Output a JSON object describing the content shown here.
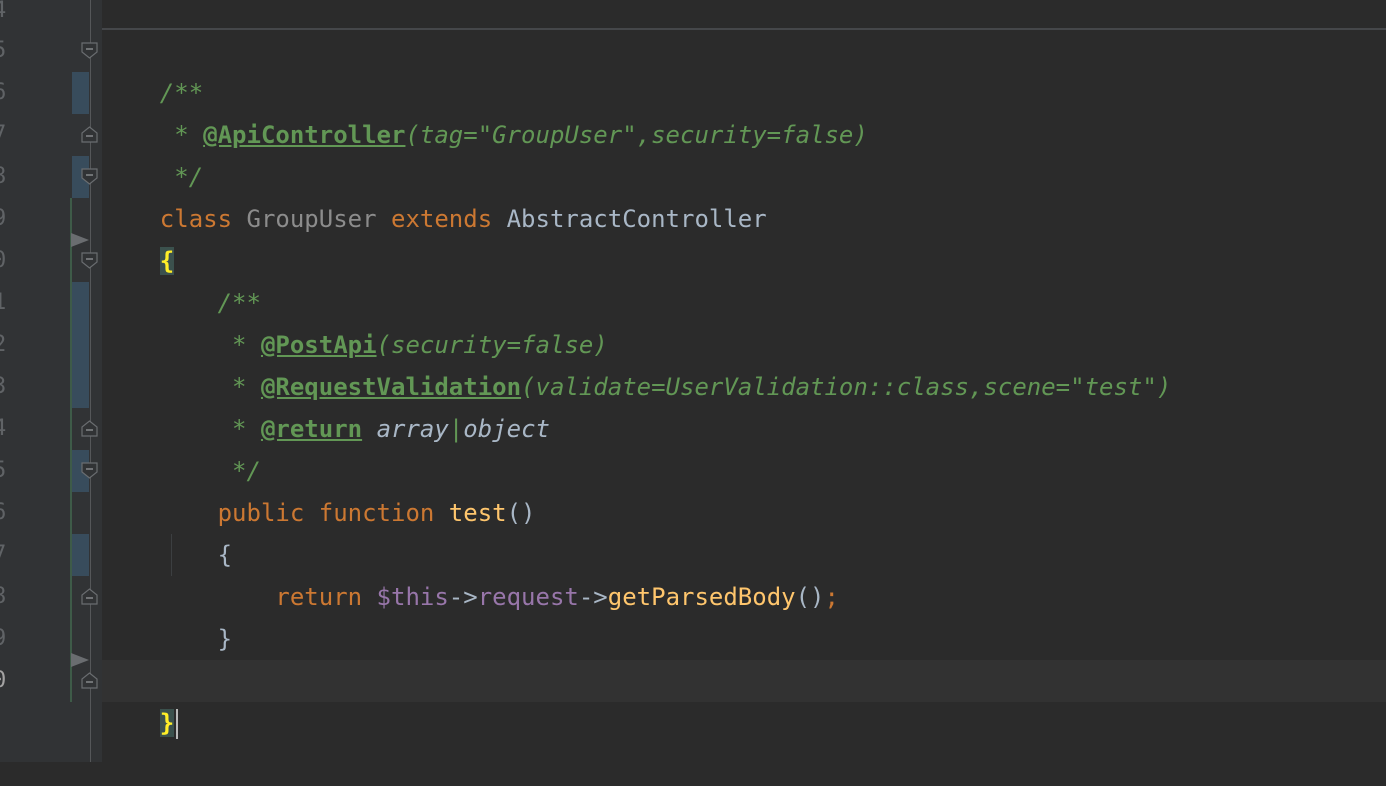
{
  "gutter": {
    "line_numbers": [
      "4",
      "5",
      "6",
      "7",
      "8",
      "9",
      "0",
      "1",
      "2",
      "3",
      "4",
      "5",
      "6",
      "7",
      "8",
      "9",
      "0"
    ],
    "current_line_index": 16
  },
  "code": {
    "l5": {
      "open": "/**"
    },
    "l6": {
      "star": " * ",
      "tag": "@ApiController",
      "args": "(tag=\"GroupUser\",security=false)"
    },
    "l7": {
      "close": " */"
    },
    "l8": {
      "kw_class": "class",
      "name": "GroupUser",
      "kw_extends": "extends",
      "parent": "AbstractController"
    },
    "l9": {
      "brace": "{"
    },
    "l10": {
      "open": "    /**"
    },
    "l11": {
      "star": "     * ",
      "tag": "@PostApi",
      "args": "(security=false)"
    },
    "l12": {
      "star": "     * ",
      "tag": "@RequestValidation",
      "args": "(validate=UserValidation::class,scene=\"test\")"
    },
    "l13": {
      "star": "     * ",
      "tag": "@return",
      "type1": "array",
      "sep": "|",
      "type2": "object"
    },
    "l14": {
      "close": "     */"
    },
    "l15": {
      "kw_public": "public",
      "kw_function": "function",
      "name": "test",
      "parens": "()"
    },
    "l16": {
      "brace": "{"
    },
    "l17": {
      "kw_return": "return",
      "this": "$this",
      "arrow1": "->",
      "prop": "request",
      "arrow2": "->",
      "method": "getParsedBody",
      "parens": "()",
      "semi": ";"
    },
    "l18": {
      "brace": "}"
    },
    "l20": {
      "brace": "}"
    }
  },
  "colors": {
    "background": "#2b2b2b",
    "doc_comment": "#629755",
    "keyword": "#cc7832",
    "function": "#ffc66d",
    "variable": "#9876aa",
    "brace_match": "#ffef28"
  }
}
